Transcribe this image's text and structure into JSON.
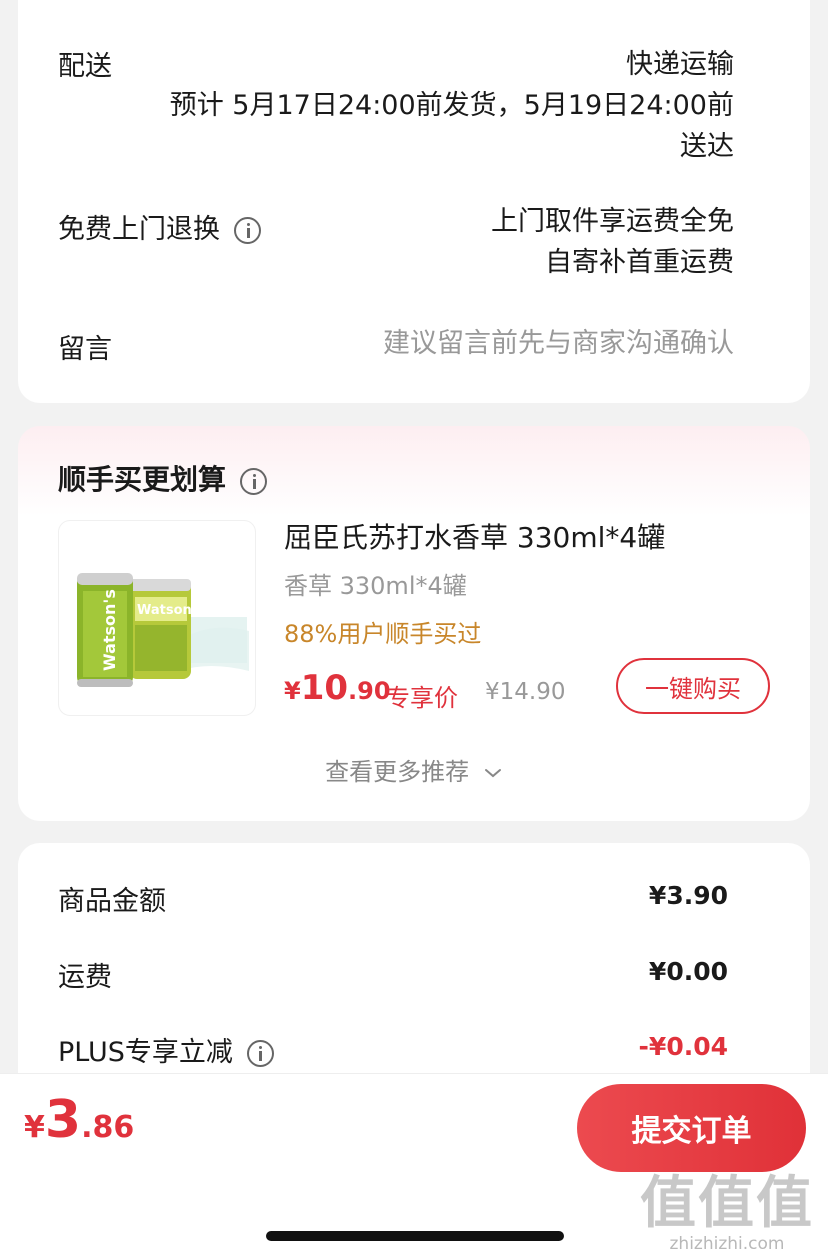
{
  "delivery": {
    "label": "配送",
    "method": "快递运输",
    "eta_line1": "预计 5月17日24:00前发货，5月19日24:00前",
    "eta_line2": "送达"
  },
  "returns": {
    "label": "免费上门退换",
    "line1": "上门取件享运费全免",
    "line2": "自寄补首重运费"
  },
  "message": {
    "label": "留言",
    "placeholder": "建议留言前先与商家沟通确认"
  },
  "upsell": {
    "title": "顺手买更划算",
    "product": {
      "name": "屈臣氏苏打水香草 330ml*4罐",
      "spec": "香草 330ml*4罐",
      "social_proof": "88%用户顺手买过",
      "price_symbol": "¥",
      "price_int": "10",
      "price_dec": ".90",
      "price_tag": "专享价",
      "original_price": "¥14.90",
      "buy_label": "一键购买",
      "image_brand": "Watson's"
    },
    "more_label": "查看更多推荐"
  },
  "amounts": {
    "items": [
      {
        "label": "商品金额",
        "value": "¥3.90"
      },
      {
        "label": "运费",
        "value": "¥0.00"
      },
      {
        "label": "PLUS专享立减",
        "value": "-¥0.04"
      }
    ]
  },
  "footer": {
    "total_symbol": "¥",
    "total_int": "3",
    "total_dec": ".86",
    "submit_label": "提交订单"
  },
  "watermark": {
    "chars": "值值值",
    "url": "zhizhizhi.com"
  },
  "colors": {
    "accent": "#e0323c",
    "social": "#c8862a",
    "muted": "#999999"
  }
}
